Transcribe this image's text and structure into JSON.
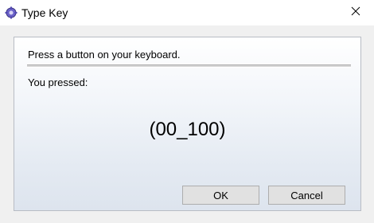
{
  "window": {
    "title": "Type Key",
    "app_icon": "keyboard-gear-icon",
    "close_icon": "close-icon"
  },
  "dialog": {
    "prompt": "Press a button on your keyboard.",
    "pressed_label": "You pressed:",
    "pressed_value": "(00_100)"
  },
  "buttons": {
    "ok_label": "OK",
    "cancel_label": "Cancel"
  },
  "colors": {
    "panel_gradient_top": "#ffffff",
    "panel_gradient_bottom": "#dde4ee",
    "button_face": "#e1e1e1",
    "button_border": "#adadad"
  }
}
